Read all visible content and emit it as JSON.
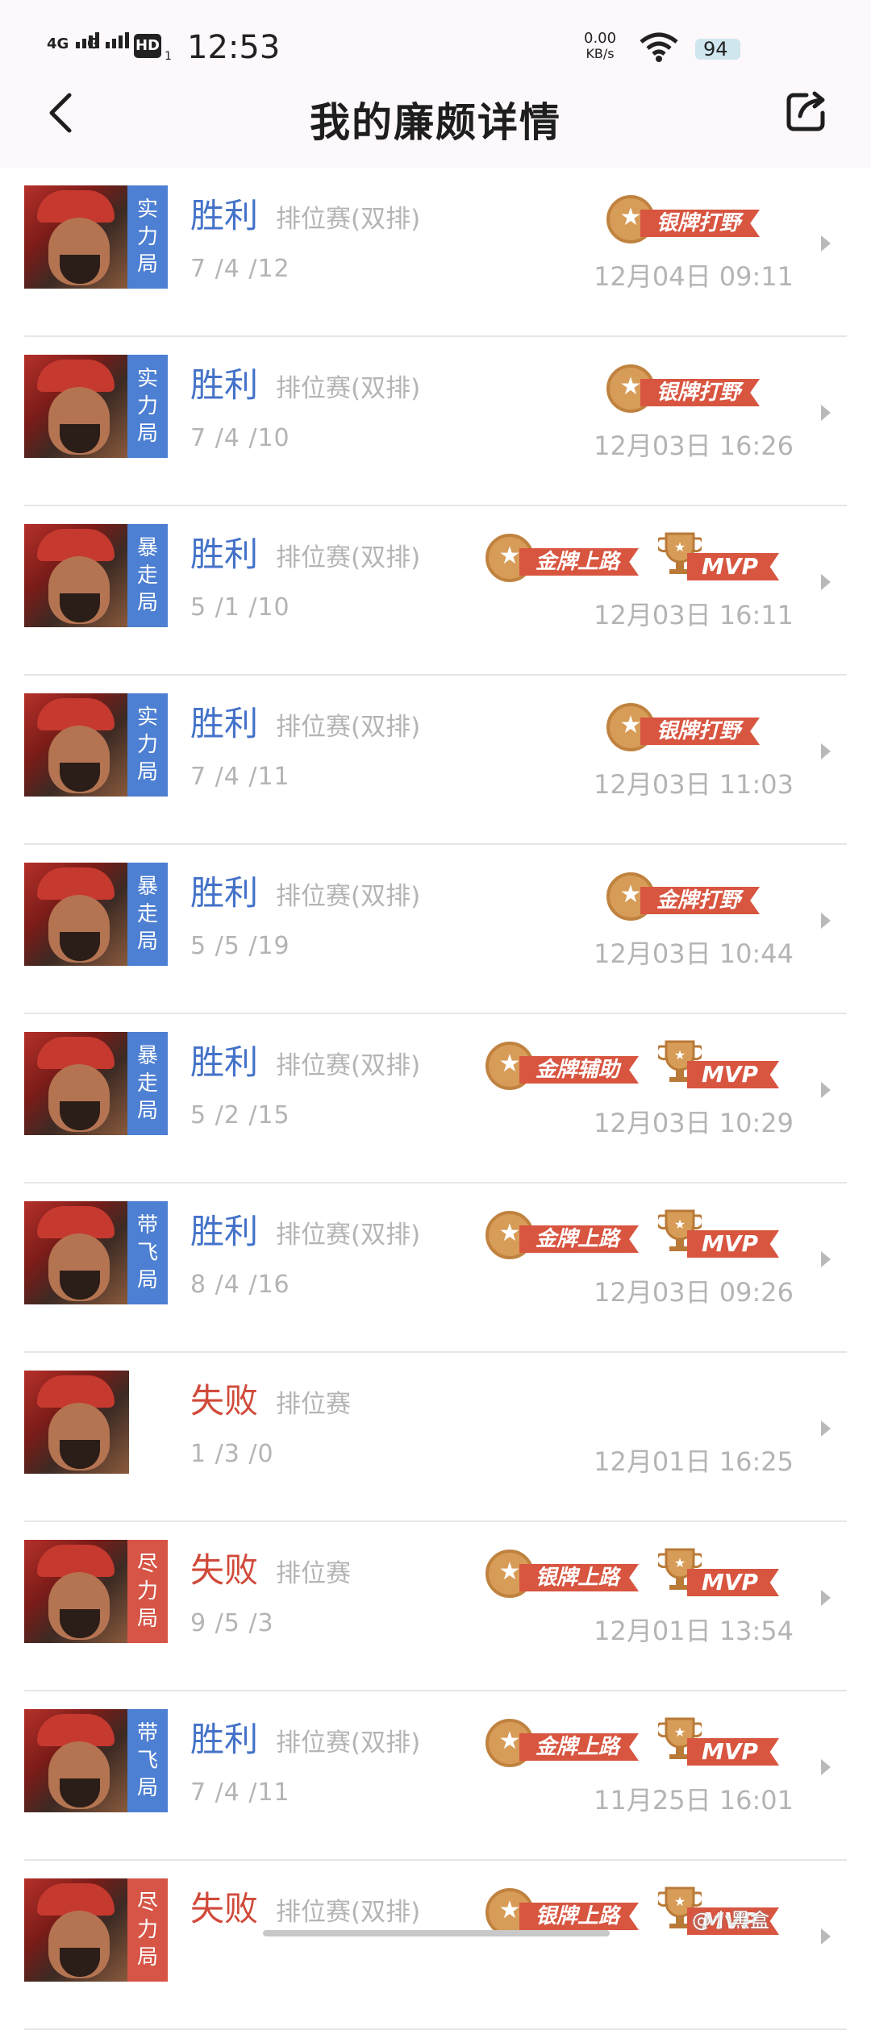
{
  "status_bar": {
    "network1": "4G",
    "network2": "G",
    "hd": "HD",
    "hd_sub": "1",
    "time": "12:53",
    "net_speed_value": "0.00",
    "net_speed_unit": "KB/s",
    "battery": "94"
  },
  "header": {
    "title": "我的廉颇详情"
  },
  "matches": [
    {
      "tag": "实力局",
      "tag_color": "#4d7fd2",
      "result": "胜利",
      "result_type": "win",
      "mode": "排位赛(双排)",
      "kda": "7 /4 /12",
      "badges": [
        "银牌打野"
      ],
      "mvp": false,
      "date": "12月04日 09:11"
    },
    {
      "tag": "实力局",
      "tag_color": "#4d7fd2",
      "result": "胜利",
      "result_type": "win",
      "mode": "排位赛(双排)",
      "kda": "7 /4 /10",
      "badges": [
        "银牌打野"
      ],
      "mvp": false,
      "date": "12月03日 16:26"
    },
    {
      "tag": "暴走局",
      "tag_color": "#4d7fd2",
      "result": "胜利",
      "result_type": "win",
      "mode": "排位赛(双排)",
      "kda": "5 /1 /10",
      "badges": [
        "金牌上路"
      ],
      "mvp": true,
      "date": "12月03日 16:11"
    },
    {
      "tag": "实力局",
      "tag_color": "#4d7fd2",
      "result": "胜利",
      "result_type": "win",
      "mode": "排位赛(双排)",
      "kda": "7 /4 /11",
      "badges": [
        "银牌打野"
      ],
      "mvp": false,
      "date": "12月03日 11:03"
    },
    {
      "tag": "暴走局",
      "tag_color": "#4d7fd2",
      "result": "胜利",
      "result_type": "win",
      "mode": "排位赛(双排)",
      "kda": "5 /5 /19",
      "badges": [
        "金牌打野"
      ],
      "mvp": false,
      "date": "12月03日 10:44"
    },
    {
      "tag": "暴走局",
      "tag_color": "#4d7fd2",
      "result": "胜利",
      "result_type": "win",
      "mode": "排位赛(双排)",
      "kda": "5 /2 /15",
      "badges": [
        "金牌辅助"
      ],
      "mvp": true,
      "date": "12月03日 10:29"
    },
    {
      "tag": "带飞局",
      "tag_color": "#4d7fd2",
      "result": "胜利",
      "result_type": "win",
      "mode": "排位赛(双排)",
      "kda": "8 /4 /16",
      "badges": [
        "金牌上路"
      ],
      "mvp": true,
      "date": "12月03日 09:26"
    },
    {
      "tag": "",
      "tag_color": "",
      "result": "失败",
      "result_type": "loss",
      "mode": "排位赛",
      "kda": "1 /3 /0",
      "badges": [],
      "mvp": false,
      "date": "12月01日 16:25"
    },
    {
      "tag": "尽力局",
      "tag_color": "#d65546",
      "result": "失败",
      "result_type": "loss",
      "mode": "排位赛",
      "kda": "9 /5 /3",
      "badges": [
        "银牌上路"
      ],
      "mvp": true,
      "date": "12月01日 13:54"
    },
    {
      "tag": "带飞局",
      "tag_color": "#4d7fd2",
      "result": "胜利",
      "result_type": "win",
      "mode": "排位赛(双排)",
      "kda": "7 /4 /11",
      "badges": [
        "金牌上路"
      ],
      "mvp": true,
      "date": "11月25日 16:01"
    },
    {
      "tag": "尽力局",
      "tag_color": "#d65546",
      "result": "失败",
      "result_type": "loss",
      "mode": "排位赛(双排)",
      "kda": "",
      "badges": [
        "银牌上路"
      ],
      "mvp": true,
      "date": ""
    }
  ],
  "mvp_label": "MVP",
  "watermark": "@小黑盒"
}
